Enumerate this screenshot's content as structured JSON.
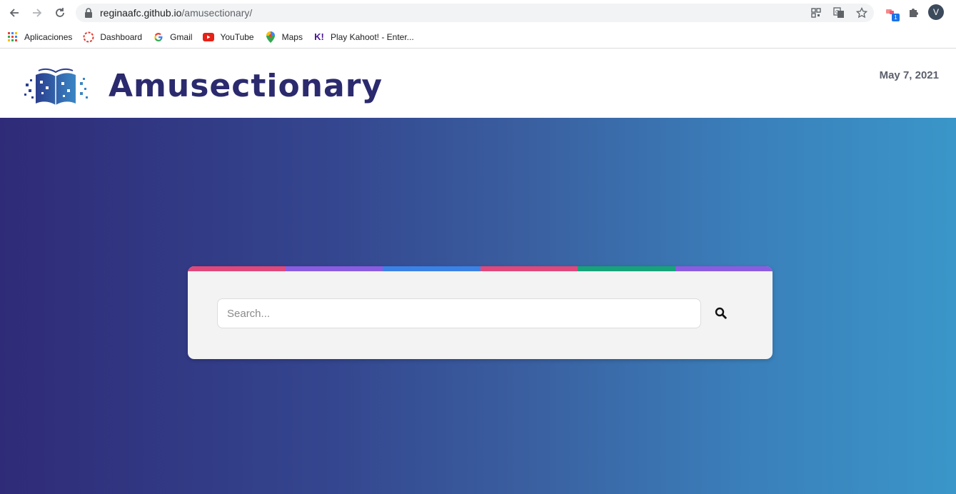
{
  "browser": {
    "url_host": "reginaafc.github.io",
    "url_path": "/amusectionary/",
    "avatar_letter": "V",
    "extension_badge": "1"
  },
  "bookmarks": [
    {
      "label": "Aplicaciones",
      "icon": "apps-grid-icon"
    },
    {
      "label": "Dashboard",
      "icon": "dashboard-icon"
    },
    {
      "label": "Gmail",
      "icon": "google-icon"
    },
    {
      "label": "YouTube",
      "icon": "youtube-icon"
    },
    {
      "label": "Maps",
      "icon": "maps-pin-icon"
    },
    {
      "label": "Play Kahoot! - Enter...",
      "icon": "kahoot-icon"
    }
  ],
  "header": {
    "brand": "Amusectionary",
    "date": "May 7, 2021"
  },
  "search": {
    "placeholder": "Search...",
    "value": ""
  },
  "colors": {
    "brand": "#2b2a6e",
    "stripe": [
      "#e0487b",
      "#8b5ce0",
      "#3b82e6",
      "#e0487b",
      "#16a37a",
      "#8b5ce0"
    ]
  }
}
